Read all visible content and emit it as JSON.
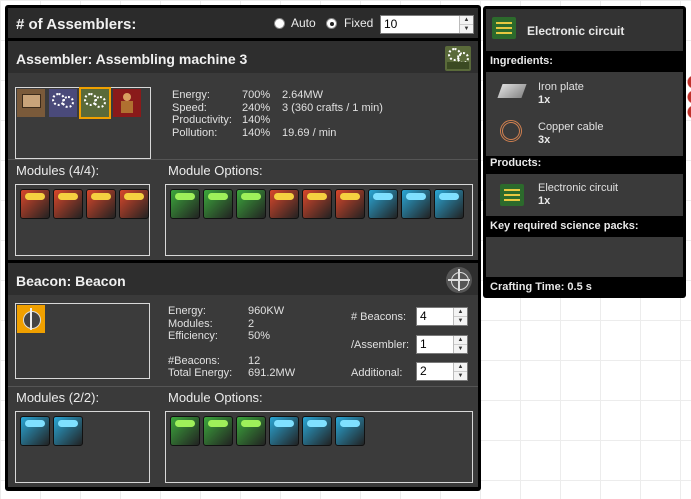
{
  "top": {
    "assemblers_label": "# of Assemblers:",
    "auto_label": "Auto",
    "fixed_label": "Fixed",
    "fixed_value": "10",
    "mode": "fixed"
  },
  "assembler": {
    "title": "Assembler: Assembling machine 3",
    "stats": [
      {
        "label": "Energy:",
        "pct": "700%",
        "value": "2.64MW"
      },
      {
        "label": "Speed:",
        "pct": "240%",
        "value": "3 (360 crafts / 1 min)"
      },
      {
        "label": "Productivity:",
        "pct": "140%",
        "value": ""
      },
      {
        "label": "Pollution:",
        "pct": "140%",
        "value": "19.69 / min"
      }
    ],
    "modules_label": "Modules (4/4):",
    "options_label": "Module Options:",
    "modules": [
      "productivity",
      "productivity",
      "productivity",
      "productivity"
    ],
    "options": [
      "efficiency",
      "efficiency",
      "efficiency",
      "productivity",
      "productivity",
      "productivity",
      "speed",
      "speed",
      "speed"
    ]
  },
  "beacon": {
    "title": "Beacon: Beacon",
    "stats": [
      {
        "label": "Energy:",
        "value": "960KW"
      },
      {
        "label": "Modules:",
        "value": "2"
      },
      {
        "label": "Efficiency:",
        "value": "50%"
      },
      {
        "label": "#Beacons:",
        "value": "12"
      },
      {
        "label": "Total Energy:",
        "value": "691.2MW"
      }
    ],
    "beacons_label": "# Beacons:",
    "beacons_value": "4",
    "per_assembler_label": "/Assembler:",
    "per_assembler_value": "1",
    "additional_label": "Additional:",
    "additional_value": "2",
    "modules_label": "Modules (2/2):",
    "options_label": "Module Options:",
    "modules": [
      "speed",
      "speed"
    ],
    "options": [
      "efficiency",
      "efficiency",
      "efficiency",
      "speed",
      "speed",
      "speed"
    ]
  },
  "tooltip": {
    "item": "Electronic circuit",
    "ingredients_label": "Ingredients:",
    "ingredients": [
      {
        "name": "Iron plate",
        "qty": "1x"
      },
      {
        "name": "Copper cable",
        "qty": "3x"
      }
    ],
    "products_label": "Products:",
    "products": [
      {
        "name": "Electronic circuit",
        "qty": "1x"
      }
    ],
    "science_label": "Key required science packs:",
    "crafting_time": "Crafting Time: 0.5 s"
  },
  "colors": {
    "productivity": "#d9472b",
    "efficiency": "#3ca83c",
    "speed": "#2aa7d6",
    "selected": "#f0a000"
  }
}
